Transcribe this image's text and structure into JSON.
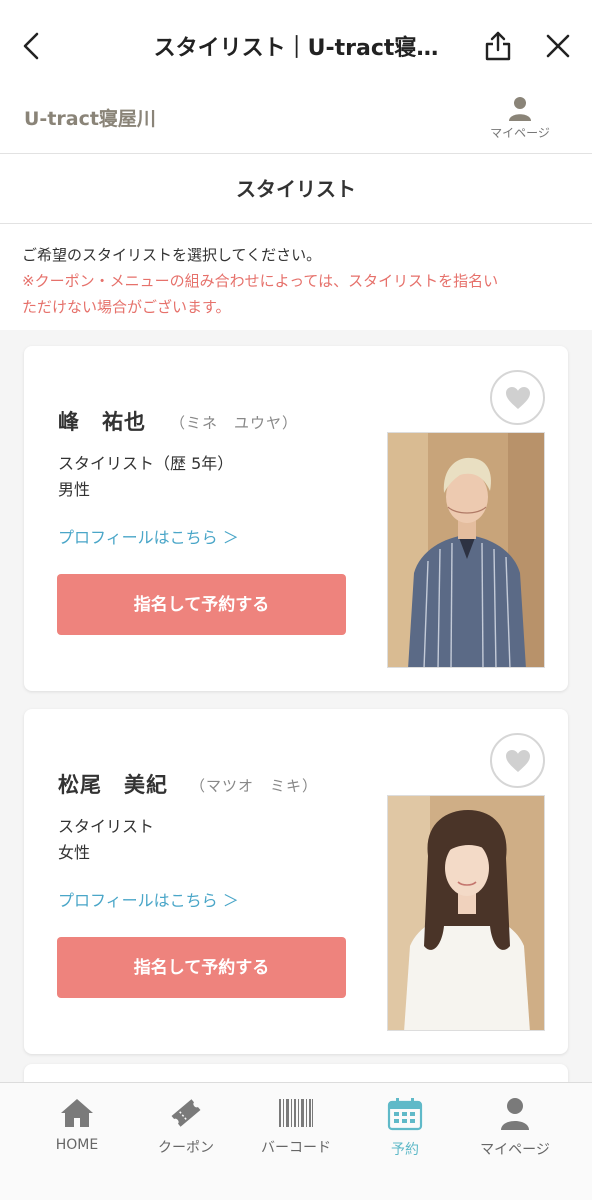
{
  "nav": {
    "title": "スタイリスト｜U-tract寝…"
  },
  "salon": {
    "name": "U-tract寝屋川",
    "mypage_label": "マイページ"
  },
  "section_title": "スタイリスト",
  "intro": {
    "line1": "ご希望のスタイリストを選択してください。",
    "line2a": "※クーポン・メニューの組み合わせによっては、スタイリストを指名い",
    "line2b": "ただけない場合がございます。"
  },
  "stylists": [
    {
      "name": "峰　祐也",
      "kana": "（ミネ　ユウヤ）",
      "role": "スタイリスト（歴 5年）",
      "gender": "男性",
      "profile_link": "プロフィールはこちら ＞",
      "reserve_label": "指名して予約する"
    },
    {
      "name": "松尾　美紀",
      "kana": "（マツオ　ミキ）",
      "role": "スタイリスト",
      "gender": "女性",
      "profile_link": "プロフィールはこちら ＞",
      "reserve_label": "指名して予約する"
    }
  ],
  "tabs": [
    {
      "label": "HOME",
      "icon": "home-icon"
    },
    {
      "label": "クーポン",
      "icon": "ticket-icon"
    },
    {
      "label": "バーコード",
      "icon": "barcode-icon"
    },
    {
      "label": "予約",
      "icon": "calendar-icon",
      "active": true
    },
    {
      "label": "マイページ",
      "icon": "person-icon"
    }
  ],
  "colors": {
    "accent_button": "#ee837d",
    "link": "#4aa6c8",
    "notice": "#e6716b",
    "active_tab": "#5fb9c8",
    "salon_name": "#8a8478"
  }
}
